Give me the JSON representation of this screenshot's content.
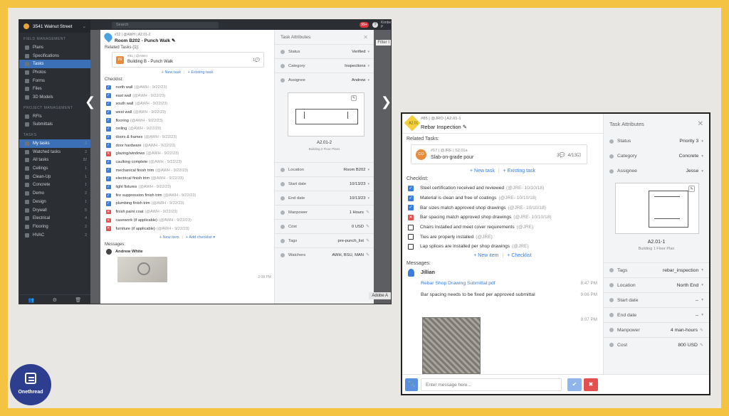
{
  "brand": {
    "name": "Onethread"
  },
  "left_app": {
    "project": "3541 Walnut Street",
    "search_placeholder": "Search",
    "notif_count": "99+",
    "user_trunc": "Kimberley P",
    "filter_trunc": "Filter t",
    "sidebar": {
      "section_project": "FIELD MANAGEMENT",
      "project_items": [
        "Plans",
        "Specifications",
        "Tasks",
        "Photos",
        "Forms",
        "Files",
        "3D Models"
      ],
      "section_mgmt": "PROJECT MANAGEMENT",
      "mgmt_items": [
        "RFIs",
        "Submittals"
      ],
      "section_tasks": "TASKS",
      "task_items": [
        {
          "label": "My tasks",
          "count": "2"
        },
        {
          "label": "Watched tasks",
          "count": "2"
        },
        {
          "label": "All tasks",
          "count": "32"
        },
        {
          "label": "Ceilings",
          "count": "1"
        },
        {
          "label": "Clean-Up",
          "count": "1"
        },
        {
          "label": "Concrete",
          "count": "1"
        },
        {
          "label": "Demo",
          "count": "2"
        },
        {
          "label": "Design",
          "count": "1"
        },
        {
          "label": "Drywall",
          "count": "5"
        },
        {
          "label": "Electrical",
          "count": "4"
        },
        {
          "label": "Flooring",
          "count": "2"
        },
        {
          "label": "HVAC",
          "count": "2"
        }
      ]
    },
    "task": {
      "meta": "#32 | @AWH | A2.01-2",
      "title": "Room B202 - Punch Walk",
      "related_label": "Related Tasks (1):",
      "related": {
        "icon": "IN",
        "meta": "#31 | @AWH",
        "title": "Building B - Punch Walk",
        "comments": "1"
      },
      "new_task": "+ New task",
      "existing_task": "+ Existing task",
      "checklist_label": "Checklist:",
      "checklist": [
        {
          "label": "north wall",
          "who": "(@AWH - 9/22/23)",
          "state": "done"
        },
        {
          "label": "east wall",
          "who": "(@AWH - 9/22/23)",
          "state": "done"
        },
        {
          "label": "south wall",
          "who": "(@AWH - 9/22/23)",
          "state": "done"
        },
        {
          "label": "west wall",
          "who": "(@AWH - 9/22/23)",
          "state": "done"
        },
        {
          "label": "flooring",
          "who": "(@AWH - 9/22/23)",
          "state": "done"
        },
        {
          "label": "ceiling",
          "who": "(@AWH - 9/22/23)",
          "state": "done"
        },
        {
          "label": "doors & frames",
          "who": "(@AWH - 9/22/23)",
          "state": "done"
        },
        {
          "label": "door hardware",
          "who": "(@AWH - 9/22/23)",
          "state": "done"
        },
        {
          "label": "glazing/windows",
          "who": "(@AWH - 9/22/23)",
          "state": "fail"
        },
        {
          "label": "caulking complete",
          "who": "(@AWH - 9/22/23)",
          "state": "done"
        },
        {
          "label": "mechanical finish trim",
          "who": "(@AWH - 9/22/23)",
          "state": "done"
        },
        {
          "label": "electrical finish trim",
          "who": "(@AWH - 9/22/23)",
          "state": "done"
        },
        {
          "label": "light fixtures",
          "who": "(@AWH - 9/22/23)",
          "state": "done"
        },
        {
          "label": "fire suppression finish trim",
          "who": "(@AWH - 9/22/23)",
          "state": "done"
        },
        {
          "label": "plumbing finish trim",
          "who": "(@AWH - 9/22/23)",
          "state": "done"
        },
        {
          "label": "finish paint coat",
          "who": "(@AWH - 9/22/23)",
          "state": "fail"
        },
        {
          "label": "casework (if applicable)",
          "who": "(@AWH - 9/22/23)",
          "state": "fail"
        },
        {
          "label": "furniture (if applicable)",
          "who": "(@AWH - 9/22/23)",
          "state": "fail"
        }
      ],
      "new_item": "+ New item",
      "add_checklist": "+ Add checklist",
      "messages_label": "Messages:",
      "message_author": "Andrew White",
      "message_time": "2:08 PM"
    },
    "attributes": {
      "title": "Task Attributes",
      "rows_top": [
        {
          "label": "Status",
          "value": "Verified"
        },
        {
          "label": "Category",
          "value": "Inspections"
        },
        {
          "label": "Assignee",
          "value": "Andrew"
        }
      ],
      "sheet_code": "A2.01-2",
      "sheet_sub": "Building 2 Floor Plans",
      "rows_bottom": [
        {
          "label": "Location",
          "value": "Room B202"
        },
        {
          "label": "Start date",
          "value": "10/13/23"
        },
        {
          "label": "End date",
          "value": "10/13/23"
        },
        {
          "label": "Manpower",
          "value": "1 Hours"
        },
        {
          "label": "Cost",
          "value": "0 USD"
        },
        {
          "label": "Tags",
          "value": "pre-punch_list"
        },
        {
          "label": "Watchers",
          "value": "AWH, BSU, MAN"
        }
      ]
    },
    "adobe_tip": "Adobe A"
  },
  "right_app": {
    "task": {
      "pin": "A2.01",
      "meta": "#85 | @JRO | A2.01-1",
      "title": "Rebar Inspection",
      "related_label": "Related Tasks:",
      "related": {
        "icon": "CO",
        "meta": "#17 | @JRE | S2.01a",
        "title": "Slab-on-grade pour",
        "comments": "3",
        "checks": "4/13"
      },
      "new_task": "+ New task",
      "existing_task": "+ Existing task",
      "checklist_label": "Checklist:",
      "checklist": [
        {
          "label": "Steel certification received and reviewed",
          "who": "(@JRE- 10/10/18)",
          "state": "done"
        },
        {
          "label": "Material is clean and free of coatings",
          "who": "(@JRE- 10/10/18)",
          "state": "done"
        },
        {
          "label": "Bar sizes match approved shop drawings",
          "who": "(@JRE- 10/10/18)",
          "state": "done"
        },
        {
          "label": "Bar spacing match approved shop drawings",
          "who": "(@JRE- 10/10/18)",
          "state": "fail"
        },
        {
          "label": "Chairs installed and meet cover requirements",
          "who": "(@JRE)",
          "state": "open"
        },
        {
          "label": "Ties are properly installed",
          "who": "(@JRE)",
          "state": "open"
        },
        {
          "label": "Lap splices are installed per shop drawings",
          "who": "(@JRE)",
          "state": "open"
        }
      ],
      "new_item": "+ New item",
      "checklist_link": "+ Checklist",
      "messages_label": "Messages:",
      "message_author": "Jillian",
      "messages": [
        {
          "text": "Rebar Shop Drawing Submittal.pdf",
          "time": "8:47 PM"
        },
        {
          "text": "Bar spacing needs to be fixed per approved submittal",
          "time": "9:06 PM"
        }
      ],
      "photo_time": "9:07 PM",
      "composer_placeholder": "Enter message here..."
    },
    "attributes": {
      "title": "Task Attributes",
      "rows_top": [
        {
          "label": "Status",
          "value": "Priority 3"
        },
        {
          "label": "Category",
          "value": "Concrete"
        },
        {
          "label": "Assignee",
          "value": "Jesse"
        }
      ],
      "sheet_code": "A2.01-1",
      "sheet_sub": "Building 1 Floor Plan",
      "rows_bottom": [
        {
          "label": "Tags",
          "value": "rebar_inspection"
        },
        {
          "label": "Location",
          "value": "North End"
        },
        {
          "label": "Start date",
          "value": "--"
        },
        {
          "label": "End date",
          "value": "--"
        },
        {
          "label": "Manpower",
          "value": "4  man-hours"
        },
        {
          "label": "Cost",
          "value": "800  USD"
        }
      ]
    }
  }
}
